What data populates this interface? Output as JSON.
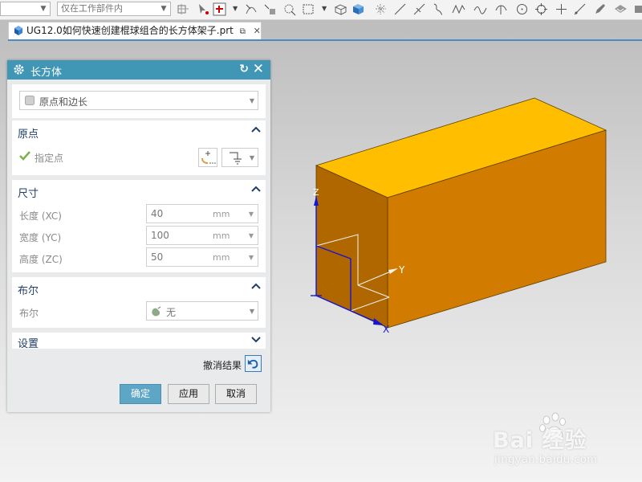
{
  "toolbar": {
    "filter_value": "",
    "scope_value": "仅在工作部件内"
  },
  "file_tab": {
    "title": "UG12.0如何快速创建棍球组合的长方体架子.prt",
    "close": "✕"
  },
  "dialog": {
    "title": "长方体",
    "type_value": "原点和边长",
    "origin": {
      "header": "原点",
      "specify_point": "指定点"
    },
    "dimensions": {
      "header": "尺寸",
      "fields": [
        {
          "label": "长度 (XC)",
          "value": "40",
          "unit": "mm"
        },
        {
          "label": "宽度 (YC)",
          "value": "100",
          "unit": "mm"
        },
        {
          "label": "高度 (ZC)",
          "value": "50",
          "unit": "mm"
        }
      ]
    },
    "boolean": {
      "header": "布尔",
      "label": "布尔",
      "value": "无"
    },
    "settings": {
      "header": "设置"
    },
    "undo_result": "撤消结果",
    "buttons": {
      "ok": "确定",
      "apply": "应用",
      "cancel": "取消"
    }
  },
  "model": {
    "axis_x": "X",
    "axis_y": "Y",
    "axis_z": "Z",
    "colors": {
      "top": "#ffbf00",
      "front": "#d17c00",
      "left": "#b06700",
      "triad": "#1515d0"
    }
  },
  "watermark": {
    "main": "Bai 经验",
    "sub": "jingyan.baidu.com"
  },
  "colors": {
    "dialog_header": "#3f96b5",
    "accent_tab": "#4a8bc4",
    "primary_button": "#5ea6c6"
  }
}
